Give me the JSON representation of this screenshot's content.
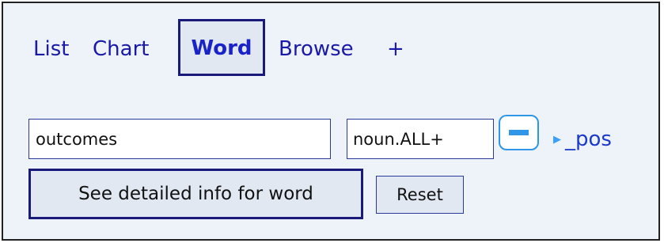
{
  "nav": {
    "list": "List",
    "chart": "Chart",
    "word": "Word",
    "browse": "Browse",
    "plus": "+"
  },
  "form": {
    "word_value": "outcomes",
    "pos_value": "noun.ALL+",
    "pos_toggle_label": "_pos",
    "detail_button": "See detailed info for word",
    "reset_button": "Reset"
  },
  "icons": {
    "remove": "minus-icon",
    "expand": "triangle-right-icon"
  },
  "colors": {
    "link": "#1a1aa8",
    "active_border": "#1a1a7a",
    "accent": "#2f96e8",
    "panel_bg": "#eef2f9"
  }
}
